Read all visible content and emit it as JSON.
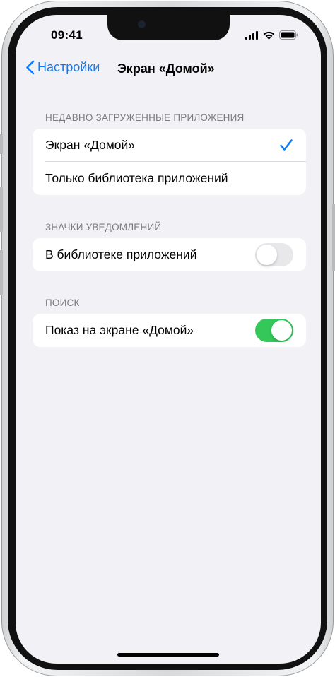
{
  "status_bar": {
    "time": "09:41",
    "icons": [
      "signal-icon",
      "wifi-icon",
      "battery-icon"
    ]
  },
  "nav": {
    "back_label": "Настройки",
    "title": "Экран «Домой»"
  },
  "sections": {
    "recent_apps": {
      "header": "НЕДАВНО ЗАГРУЖЕННЫЕ ПРИЛОЖЕНИЯ",
      "options": [
        {
          "label": "Экран «Домой»",
          "selected": true
        },
        {
          "label": "Только библиотека приложений",
          "selected": false
        }
      ]
    },
    "badges": {
      "header": "ЗНАЧКИ УВЕДОМЛЕНИЙ",
      "label": "В библиотеке приложений",
      "enabled": false
    },
    "search": {
      "header": "ПОИСК",
      "label": "Показ на экране «Домой»",
      "enabled": true
    }
  },
  "colors": {
    "accent": "#0a7aff",
    "toggle_on": "#34c759",
    "toggle_off": "#e8e8ea",
    "background": "#f2f1f6"
  }
}
